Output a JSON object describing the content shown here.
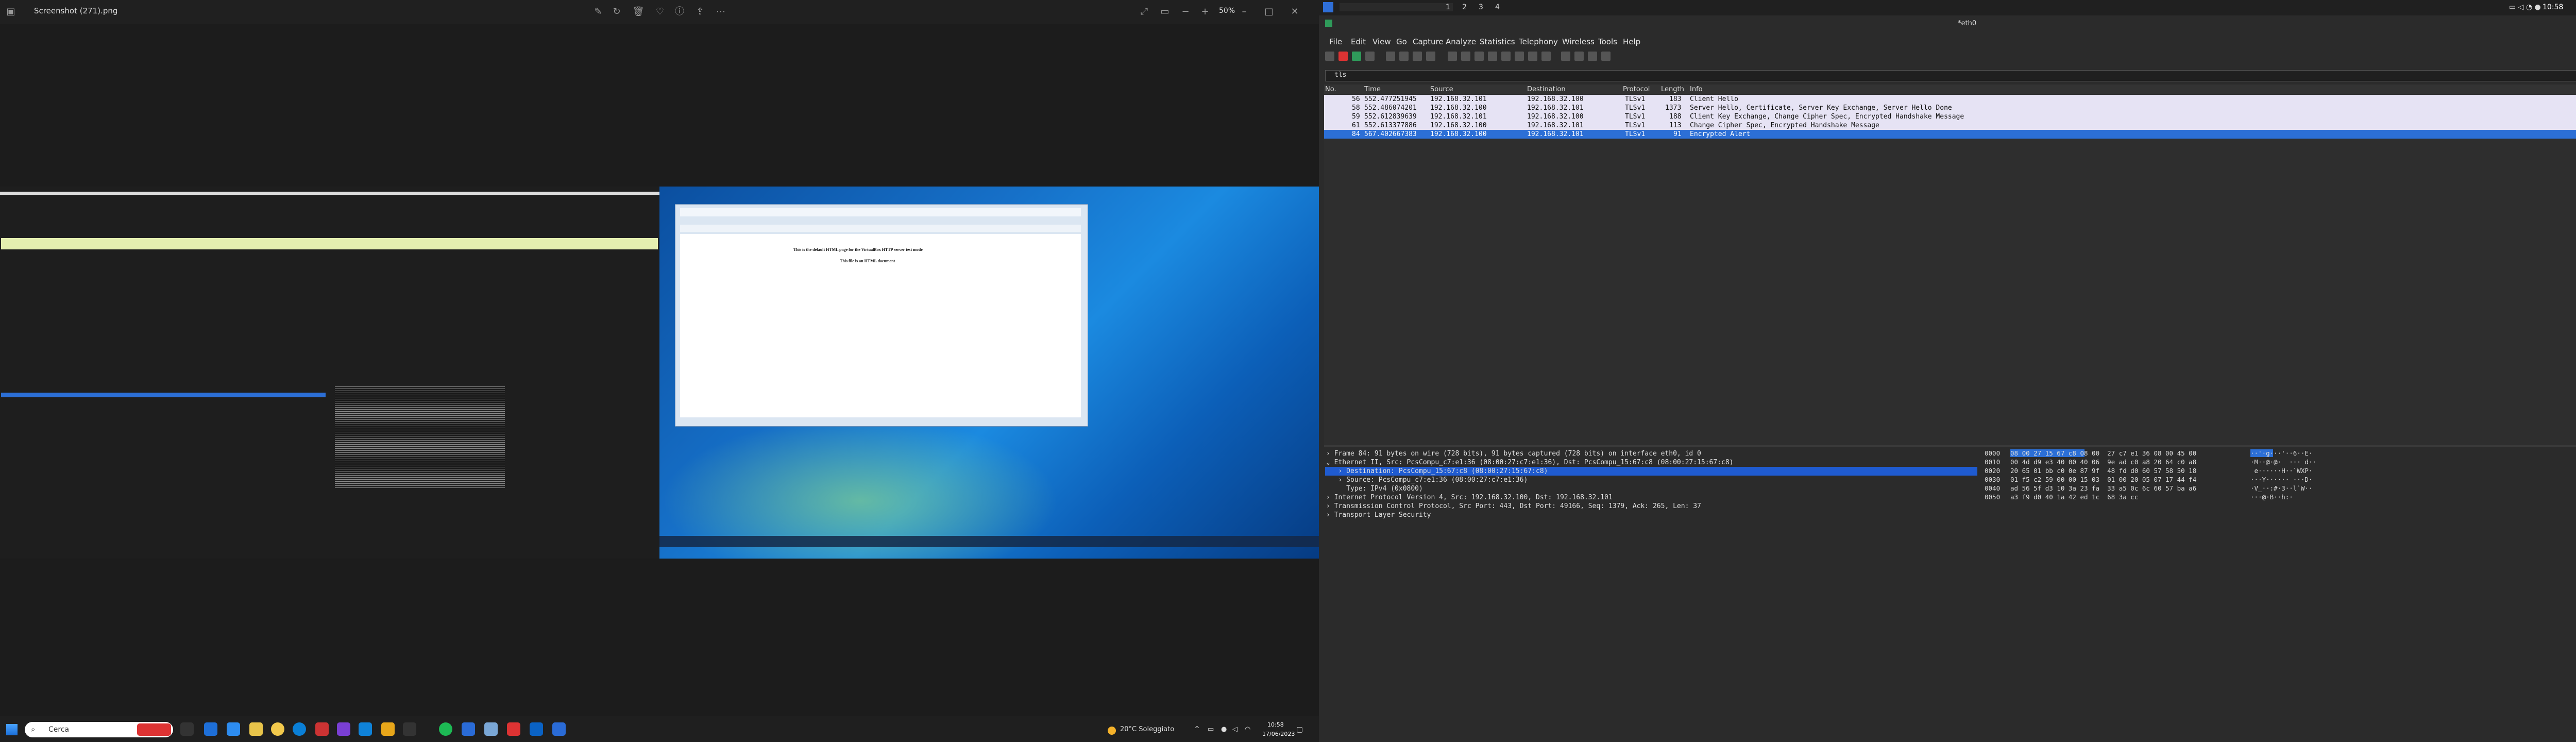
{
  "viewer": {
    "filename": "Screenshot (271).png",
    "zoom": "50%",
    "nested": {
      "vm_line1": "This is the default HTML page for the VirtualBox HTTP server test mode",
      "vm_line2": "This file is an HTML document"
    }
  },
  "taskbar": {
    "search_placeholder": "Cerca",
    "weather": "20°C Soleggiato",
    "time": "10:58",
    "date": "17/06/2023"
  },
  "os_bar": {
    "workspaces": [
      "1",
      "2",
      "3",
      "4"
    ],
    "clock": "10:58"
  },
  "wireshark": {
    "title": "*eth0",
    "menu": [
      "File",
      "Edit",
      "View",
      "Go",
      "Capture",
      "Analyze",
      "Statistics",
      "Telephony",
      "Wireless",
      "Tools",
      "Help"
    ],
    "filter": "tls",
    "columns": [
      "No.",
      "Time",
      "Source",
      "Destination",
      "Protocol",
      "Length",
      "Info"
    ],
    "packets": [
      {
        "no": "56",
        "time": "552.477251945",
        "src": "192.168.32.101",
        "dst": "192.168.32.100",
        "proto": "TLSv1",
        "len": "183",
        "info": "Client Hello",
        "selected": false
      },
      {
        "no": "58",
        "time": "552.486074201",
        "src": "192.168.32.100",
        "dst": "192.168.32.101",
        "proto": "TLSv1",
        "len": "1373",
        "info": "Server Hello, Certificate, Server Key Exchange, Server Hello Done",
        "selected": false
      },
      {
        "no": "59",
        "time": "552.612839639",
        "src": "192.168.32.101",
        "dst": "192.168.32.100",
        "proto": "TLSv1",
        "len": "188",
        "info": "Client Key Exchange, Change Cipher Spec, Encrypted Handshake Message",
        "selected": false
      },
      {
        "no": "61",
        "time": "552.613377886",
        "src": "192.168.32.100",
        "dst": "192.168.32.101",
        "proto": "TLSv1",
        "len": "113",
        "info": "Change Cipher Spec, Encrypted Handshake Message",
        "selected": false
      },
      {
        "no": "84",
        "time": "567.402667383",
        "src": "192.168.32.100",
        "dst": "192.168.32.101",
        "proto": "TLSv1",
        "len": "91",
        "info": "Encrypted Alert",
        "selected": true
      }
    ],
    "details": [
      {
        "text": "› Frame 84: 91 bytes on wire (728 bits), 91 bytes captured (728 bits) on interface eth0, id 0",
        "selected": false
      },
      {
        "text": "⌄ Ethernet II, Src: PcsCompu_c7:e1:36 (08:00:27:c7:e1:36), Dst: PcsCompu_15:67:c8 (08:00:27:15:67:c8)",
        "selected": false
      },
      {
        "text": "   › Destination: PcsCompu_15:67:c8 (08:00:27:15:67:c8)",
        "selected": true
      },
      {
        "text": "   › Source: PcsCompu_c7:e1:36 (08:00:27:c7:e1:36)",
        "selected": false
      },
      {
        "text": "     Type: IPv4 (0x0800)",
        "selected": false
      },
      {
        "text": "› Internet Protocol Version 4, Src: 192.168.32.100, Dst: 192.168.32.101",
        "selected": false
      },
      {
        "text": "› Transmission Control Protocol, Src Port: 443, Dst Port: 49166, Seq: 1379, Ack: 265, Len: 37",
        "selected": false
      },
      {
        "text": "› Transport Layer Security",
        "selected": false
      }
    ],
    "hex": [
      {
        "off": "0000",
        "bytes": "08 00 27 15 67 c8 08 00  27 c7 e1 36 08 00 45 00",
        "ascii": "··'·g···'··6··E·"
      },
      {
        "off": "0010",
        "bytes": "00 4d d9 e3 40 00 40 06  9e ad c0 a8 20 64 c0 a8",
        "ascii": "·M··@·@·  ··· d··"
      },
      {
        "off": "0020",
        "bytes": "20 65 01 bb c0 0e 87 9f  48 fd d0 60 57 58 50 18",
        "ascii": " e······H··`WXP·"
      },
      {
        "off": "0030",
        "bytes": "01 f5 c2 59 00 00 15 03  01 00 20 05 07 17 44 f4",
        "ascii": "···Y······ ···D·"
      },
      {
        "off": "0040",
        "bytes": "ad 56 5f d3 10 3a 23 fa  33 a5 0c 6c 60 57 ba a6",
        "ascii": "·V_··:#·3··l`W··"
      },
      {
        "off": "0050",
        "bytes": "a3 f9 d0 40 1a 42 ed 1c  68 3a cc",
        "ascii": "···@·B··h:·"
      }
    ]
  }
}
